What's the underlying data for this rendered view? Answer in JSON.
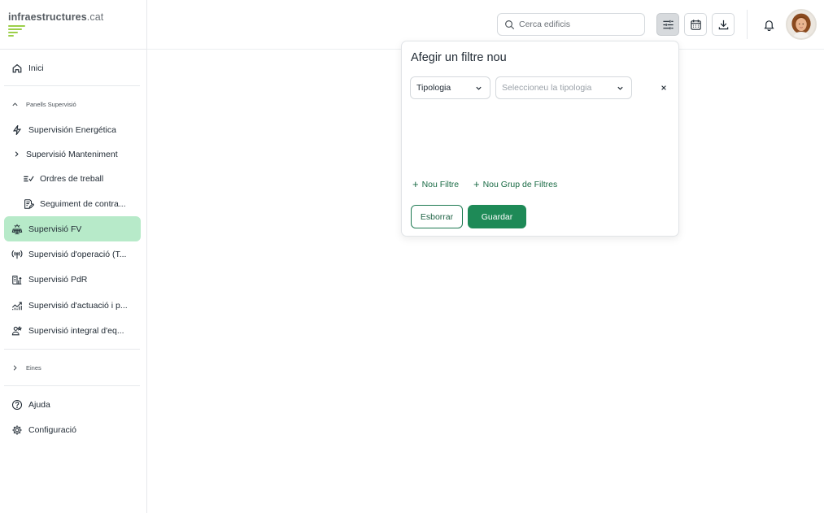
{
  "brand": {
    "logo_prefix": "infraestructures",
    "logo_suffix": ".cat",
    "logo_bar_color": "#9ccf4a"
  },
  "sidebar": {
    "home": {
      "label": "Inici",
      "icon": "home-icon"
    },
    "section_panells": {
      "label": "Panells Supervisió",
      "expanded": true
    },
    "items": [
      {
        "label": "Supervisión Energética",
        "icon": "lightning-icon"
      },
      {
        "label": "Supervisió Manteniment",
        "icon": "chevron-right-icon"
      },
      {
        "label": "Ordres de treball",
        "icon": "checklist-icon"
      },
      {
        "label": "Seguiment de contra...",
        "icon": "contract-edit-icon"
      },
      {
        "label": "Supervisió FV",
        "icon": "solar-panel-icon",
        "active": true
      },
      {
        "label": "Supervisió d'operació (T...",
        "icon": "antenna-icon"
      },
      {
        "label": "Supervisió PdR",
        "icon": "building-chart-icon"
      },
      {
        "label": "Supervisió d'actuació i p...",
        "icon": "trend-chart-icon"
      },
      {
        "label": "Supervisió integral d'eq...",
        "icon": "people-icon"
      }
    ],
    "section_eines": {
      "label": "Eines",
      "expanded": false
    },
    "help": {
      "label": "Ajuda",
      "icon": "help-icon"
    },
    "settings": {
      "label": "Configuració",
      "icon": "gear-icon"
    }
  },
  "topbar": {
    "search": {
      "placeholder": "Cerca edificis",
      "value": ""
    },
    "buttons": [
      "filter-sliders-icon",
      "calendar-icon",
      "download-icon"
    ],
    "notification_icon": "bell-icon"
  },
  "filter_popover": {
    "title": "Afegir un filtre nou",
    "field_select": {
      "value": "Tipologia"
    },
    "value_select": {
      "placeholder": "Seleccioneu la tipologia"
    },
    "add_filter": "Nou Filtre",
    "add_group": "Nou Grup de Filtres",
    "clear_button": "Esborrar",
    "save_button": "Guardar",
    "accent_color": "#1e8a57"
  }
}
